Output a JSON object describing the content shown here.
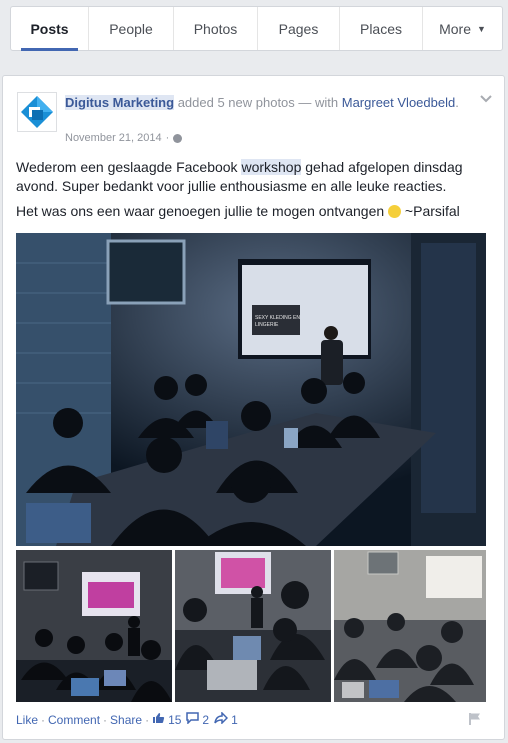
{
  "tabs": [
    {
      "label": "Posts",
      "active": true
    },
    {
      "label": "People"
    },
    {
      "label": "Photos"
    },
    {
      "label": "Pages"
    },
    {
      "label": "Places"
    },
    {
      "label": "More"
    }
  ],
  "post": {
    "actor": "Digitus Marketing",
    "action_text": " added 5 new photos — with ",
    "tagged": "Margreet Vloedbeld",
    "tagged_suffix": ".",
    "date": "November 21, 2014",
    "date_sep": " · ",
    "text1_before": "Wederom een geslaagde Facebook ",
    "text1_highlight": "workshop",
    "text1_after": " gehad afgelopen dinsdag avond. Super bedankt voor jullie enthousiasme en alle leuke reacties.",
    "text2_before": "Het was ons een waar genoegen jullie te mogen ontvangen ",
    "text2_after": " ~Parsifal",
    "slide_line1": "SEXY KLEDING EN",
    "slide_line2": "LINGERIE"
  },
  "actions": {
    "like": "Like",
    "comment": "Comment",
    "share": "Share",
    "dot": " · ",
    "likes": "15",
    "comments": "2",
    "shares": "1"
  },
  "colors": {
    "link": "#4267b2",
    "brand_blue": "#1a8fd6",
    "text": "#1d2129",
    "muted": "#90949c"
  },
  "icons": [
    "chevron-down-icon",
    "globe-icon",
    "smiley-icon",
    "like-icon",
    "comment-icon",
    "share-icon",
    "flag-icon"
  ]
}
